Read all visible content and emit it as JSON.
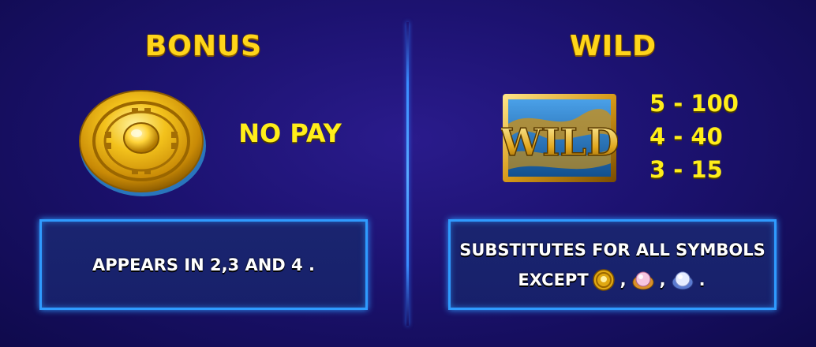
{
  "bonus": {
    "title": "BONUS",
    "pay_text": "NO PAY",
    "description": "APPEARS IN 2,3 AND 4 .",
    "icon": "gold-coin-icon"
  },
  "wild": {
    "title": "WILD",
    "symbol_text": "WILD",
    "icon": "wild-symbol-icon",
    "pays": [
      "5 - 100",
      "4 - 40",
      "3 - 15"
    ],
    "description_line1": "SUBSTITUTES FOR ALL SYMBOLS",
    "description_line2_prefix": "EXCEPT",
    "except_icons": [
      "gold-coin-icon",
      "pink-pearl-icon",
      "blue-pearl-icon"
    ],
    "separator": ",",
    "terminator": "."
  },
  "colors": {
    "title_gold": "#ffd51a",
    "pay_yellow": "#ffee1a",
    "box_border": "#2f9bff",
    "background": "#1c1270"
  }
}
